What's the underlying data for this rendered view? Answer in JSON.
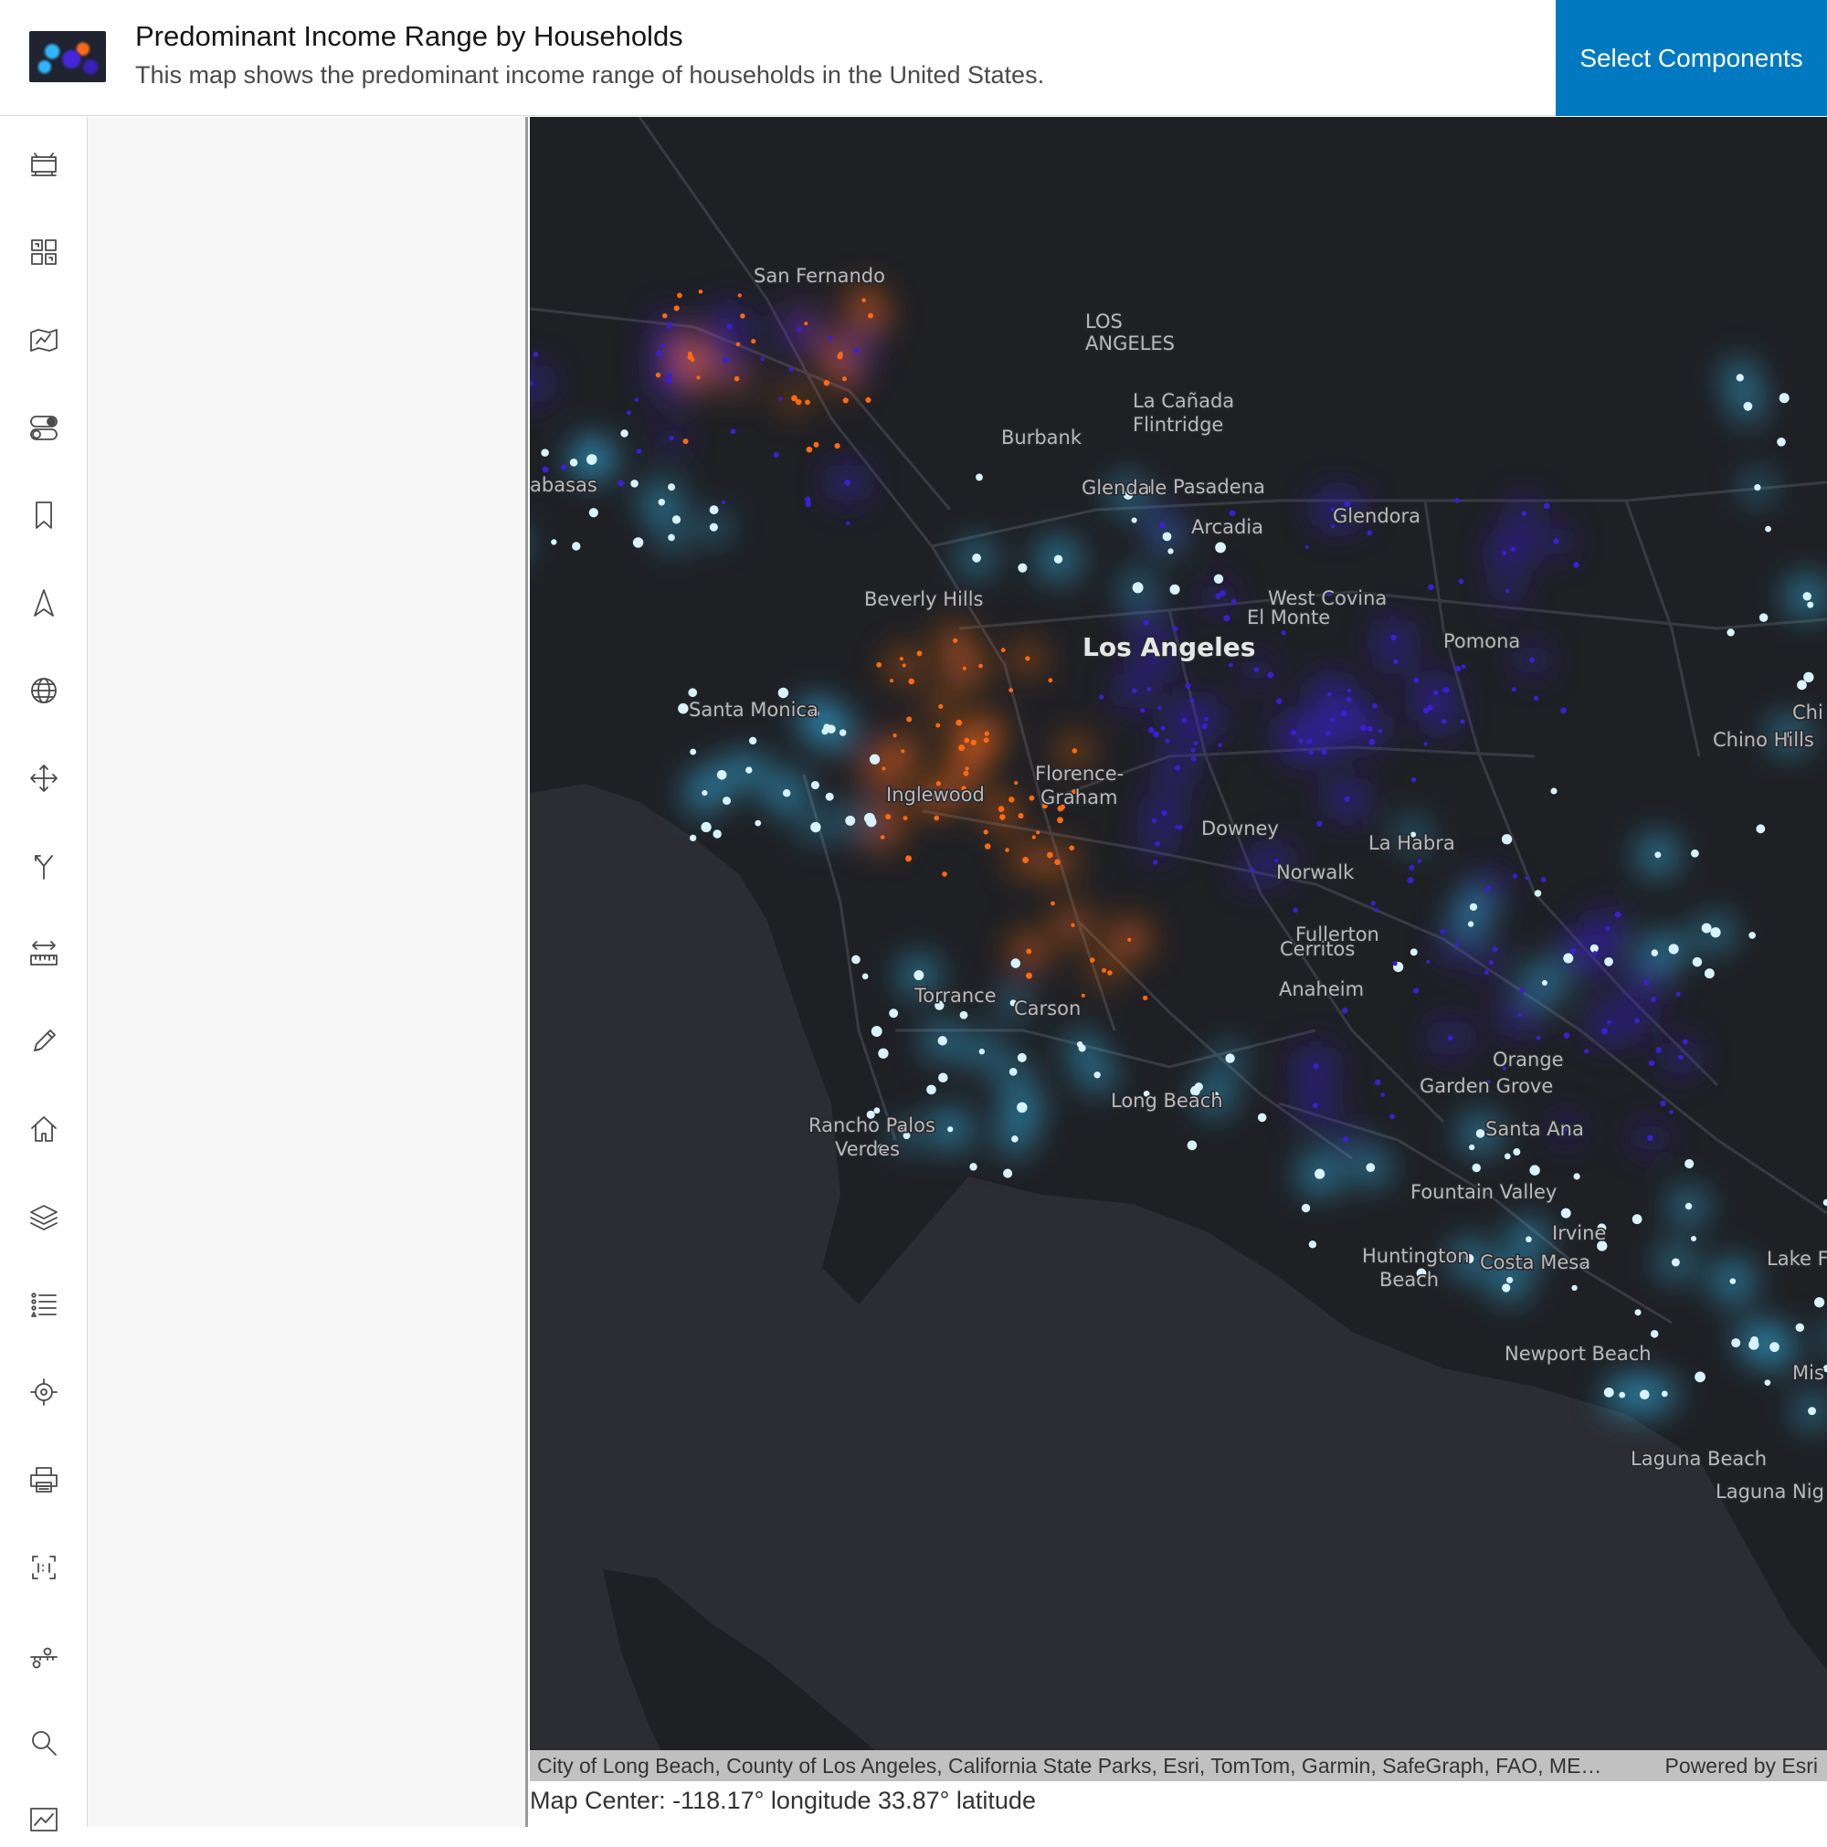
{
  "header": {
    "title": "Predominant Income Range by Households",
    "subtitle": "This map shows the predominant income range of households in the United States.",
    "select_components_label": "Select Components"
  },
  "toolbar": {
    "items": [
      {
        "name": "basemap-gallery-icon"
      },
      {
        "name": "grid-widgets-icon"
      },
      {
        "name": "map-icon"
      },
      {
        "name": "toggle-icon"
      },
      {
        "name": "bookmark-icon"
      },
      {
        "name": "navigate-arrow-icon"
      },
      {
        "name": "globe-icon"
      },
      {
        "name": "pan-icon"
      },
      {
        "name": "branch-icon"
      },
      {
        "name": "measure-icon"
      },
      {
        "name": "pencil-icon"
      },
      {
        "name": "home-icon"
      },
      {
        "name": "layers-icon"
      },
      {
        "name": "legend-list-icon"
      },
      {
        "name": "locate-icon"
      },
      {
        "name": "print-icon"
      },
      {
        "name": "scale-icon"
      },
      {
        "name": "slider-icon"
      },
      {
        "name": "search-icon"
      },
      {
        "name": "chart-icon"
      }
    ]
  },
  "map": {
    "place_labels": [
      "San Fernando",
      "LOS",
      "ANGELES",
      "La Cañada",
      "Flintridge",
      "Burbank",
      "Glendale",
      "Pasadena",
      "Arcadia",
      "Glendora",
      "abasas",
      "Beverly Hills",
      "El Monte",
      "West Covina",
      "Los Angeles",
      "Pomona",
      "Chi",
      "Chino Hills",
      "Santa Monica",
      "Florence-",
      "Graham",
      "Inglewood",
      "Downey",
      "La Habra",
      "Norwalk",
      "Cerritos",
      "Fullerton",
      "Anaheim",
      "Torrance",
      "Carson",
      "Orange",
      "Garden Grove",
      "Long Beach",
      "Santa Ana",
      "Rancho Palos",
      "Verdes",
      "Fountain Valley",
      "Irvine",
      "Lake F",
      "Huntington",
      "Beach",
      "Costa Mesa",
      "Newport Beach",
      "Mis",
      "Laguna Beach",
      "Laguna Nig"
    ],
    "attribution": "City of Long Beach, County of Los Angeles, California State Parks, Esri, TomTom, Garmin, SafeGraph, FAO, ME…",
    "powered_by": "Powered by Esri",
    "colors": {
      "background": "#26272c",
      "ocean": "#2c2d33",
      "land": "#1f2024",
      "roads": "#3a3b42",
      "income_high": "#35c4ff",
      "income_mid": "#3b1fd0",
      "income_low": "#ff6a10"
    }
  },
  "map_center": "Map Center: -118.17° longitude 33.87° latitude"
}
